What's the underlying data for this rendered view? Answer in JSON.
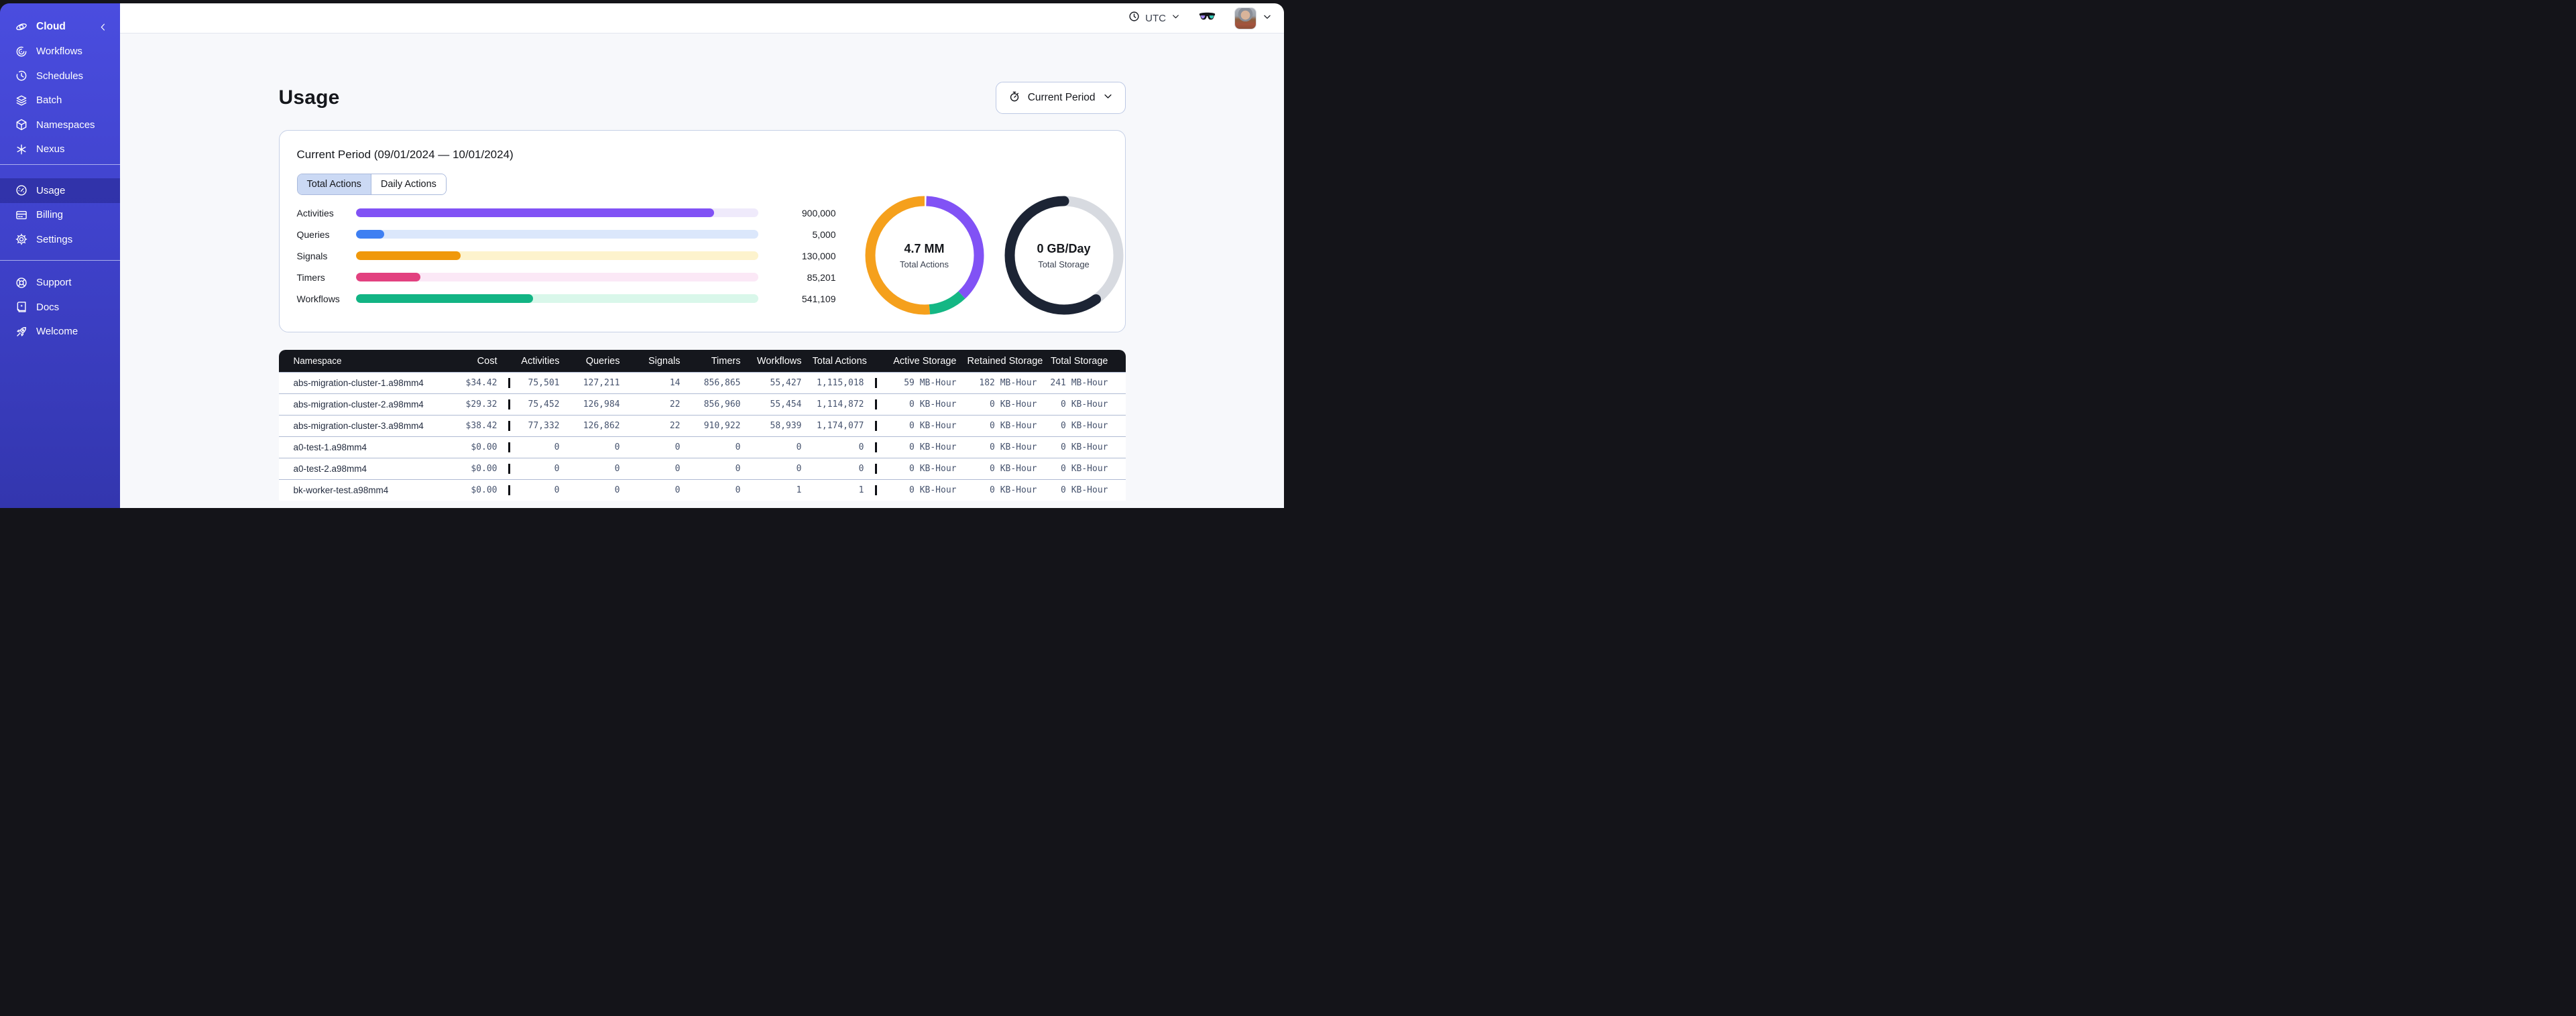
{
  "sidebar": {
    "header_label": "Cloud",
    "items_main": [
      {
        "label": "Workflows"
      },
      {
        "label": "Schedules"
      },
      {
        "label": "Batch"
      },
      {
        "label": "Namespaces"
      },
      {
        "label": "Nexus"
      }
    ],
    "items_account": [
      {
        "label": "Usage"
      },
      {
        "label": "Billing"
      },
      {
        "label": "Settings"
      }
    ],
    "items_footer": [
      {
        "label": "Support"
      },
      {
        "label": "Docs"
      },
      {
        "label": "Welcome"
      }
    ]
  },
  "topbar": {
    "timezone": "UTC"
  },
  "page": {
    "title": "Usage",
    "period_button_label": "Current Period"
  },
  "usage_card": {
    "title": "Current Period (09/01/2024 — 10/01/2024)",
    "tabs": [
      {
        "label": "Total Actions"
      },
      {
        "label": "Daily Actions"
      }
    ],
    "bars": [
      {
        "label": "Activities",
        "value": "900,000",
        "pct": 89,
        "fill": "#8152F5",
        "track": "#EFEAFB"
      },
      {
        "label": "Queries",
        "value": "5,000",
        "pct": 7,
        "fill": "#3E7FF2",
        "track": "#DBE7FB"
      },
      {
        "label": "Signals",
        "value": "130,000",
        "pct": 26,
        "fill": "#F0980B",
        "track": "#FDF3CD"
      },
      {
        "label": "Timers",
        "value": "85,201",
        "pct": 16,
        "fill": "#E2417F",
        "track": "#FBE8F6"
      },
      {
        "label": "Workflows",
        "value": "541,109",
        "pct": 44,
        "fill": "#12B484",
        "track": "#D9F7EA"
      }
    ],
    "donuts": [
      {
        "value": "4.7 MM",
        "label": "Total Actions",
        "segments": [
          {
            "color": "#8152F5",
            "from": 0.005,
            "to": 0.38
          },
          {
            "color": "#14B784",
            "from": 0.38,
            "to": 0.485
          },
          {
            "color": "#F5A01C",
            "from": 0.485,
            "to": 1.005
          }
        ]
      },
      {
        "value": "0 GB/Day",
        "label": "Total Storage",
        "segments": [
          {
            "color": "#D7DAE0",
            "from": 0.0,
            "to": 0.4
          },
          {
            "color": "#1C2434",
            "from": 0.4,
            "to": 1.0
          }
        ]
      }
    ]
  },
  "table": {
    "columns": [
      "Namespace",
      "Cost",
      "Activities",
      "Queries",
      "Signals",
      "Timers",
      "Workflows",
      "Total Actions",
      "Active Storage",
      "Retained Storage",
      "Total Storage"
    ],
    "rows": [
      {
        "namespace": "abs-migration-cluster-1.a98mm4",
        "cost": "$34.42",
        "activities": "75,501",
        "queries": "127,211",
        "signals": "14",
        "timers": "856,865",
        "workflows": "55,427",
        "total_actions": "1,115,018",
        "active_storage": "59 MB-Hour",
        "retained_storage": "182 MB-Hour",
        "total_storage": "241 MB-Hour"
      },
      {
        "namespace": "abs-migration-cluster-2.a98mm4",
        "cost": "$29.32",
        "activities": "75,452",
        "queries": "126,984",
        "signals": "22",
        "timers": "856,960",
        "workflows": "55,454",
        "total_actions": "1,114,872",
        "active_storage": "0 KB-Hour",
        "retained_storage": "0 KB-Hour",
        "total_storage": "0 KB-Hour"
      },
      {
        "namespace": "abs-migration-cluster-3.a98mm4",
        "cost": "$38.42",
        "activities": "77,332",
        "queries": "126,862",
        "signals": "22",
        "timers": "910,922",
        "workflows": "58,939",
        "total_actions": "1,174,077",
        "active_storage": "0 KB-Hour",
        "retained_storage": "0 KB-Hour",
        "total_storage": "0 KB-Hour"
      },
      {
        "namespace": "a0-test-1.a98mm4",
        "cost": "$0.00",
        "activities": "0",
        "queries": "0",
        "signals": "0",
        "timers": "0",
        "workflows": "0",
        "total_actions": "0",
        "active_storage": "0 KB-Hour",
        "retained_storage": "0 KB-Hour",
        "total_storage": "0 KB-Hour"
      },
      {
        "namespace": "a0-test-2.a98mm4",
        "cost": "$0.00",
        "activities": "0",
        "queries": "0",
        "signals": "0",
        "timers": "0",
        "workflows": "0",
        "total_actions": "0",
        "active_storage": "0 KB-Hour",
        "retained_storage": "0 KB-Hour",
        "total_storage": "0 KB-Hour"
      },
      {
        "namespace": "bk-worker-test.a98mm4",
        "cost": "$0.00",
        "activities": "0",
        "queries": "0",
        "signals": "0",
        "timers": "0",
        "workflows": "1",
        "total_actions": "1",
        "active_storage": "0 KB-Hour",
        "retained_storage": "0 KB-Hour",
        "total_storage": "0 KB-Hour"
      }
    ]
  }
}
